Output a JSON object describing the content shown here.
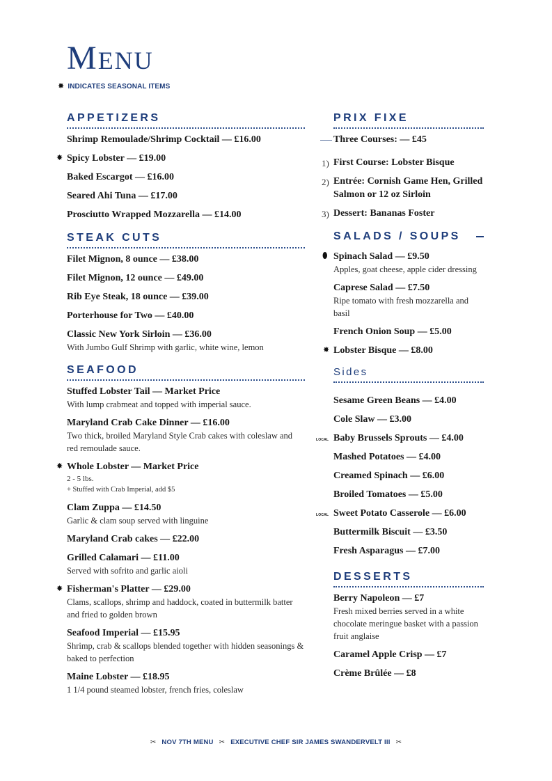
{
  "header": {
    "title_first": "M",
    "title_rest": "ENU",
    "legend_icon": "seasonal-star-icon",
    "legend_text": "INDICATES SEASONAL ITEMS"
  },
  "marker_glyphs": {
    "seasonal": "✸",
    "leaf": "⬮",
    "local": "LOCAL"
  },
  "left": {
    "appetizers": {
      "heading": "APPETIZERS",
      "items": [
        {
          "name": "Shrimp Remoulade/Shrimp Cocktail — £16.00"
        },
        {
          "name": "Spicy Lobster — £19.00",
          "marker": "seasonal"
        },
        {
          "name": "Baked Escargot — £16.00"
        },
        {
          "name": "Seared Ahi Tuna — £17.00"
        },
        {
          "name": "Prosciutto Wrapped Mozzarella — £14.00"
        }
      ]
    },
    "steak": {
      "heading": "STEAK CUTS",
      "items": [
        {
          "name": "Filet Mignon, 8 ounce — £38.00"
        },
        {
          "name": "Filet Mignon, 12 ounce — £49.00"
        },
        {
          "name": "Rib Eye Steak, 18 ounce — £39.00"
        },
        {
          "name": "Porterhouse for Two — £40.00"
        },
        {
          "name": "Classic New York Sirloin — £36.00",
          "desc": "With Jumbo Gulf Shrimp with garlic, white wine, lemon"
        }
      ]
    },
    "seafood": {
      "heading": "SEAFOOD",
      "items": [
        {
          "name": "Stuffed Lobster Tail  — Market Price",
          "desc": "With lump crabmeat and topped with imperial sauce."
        },
        {
          "name": "Maryland Crab Cake Dinner  — £16.00",
          "desc": "Two thick, broiled Maryland Style Crab cakes with coleslaw and red remoulade sauce."
        },
        {
          "name": "Whole Lobster — Market Price",
          "marker": "seasonal",
          "desc": "2 - 5 lbs.",
          "desc2": "+ Stuffed with Crab Imperial, add $5"
        },
        {
          "name": "Clam Zuppa — £14.50",
          "desc": "Garlic & clam soup served with linguine"
        },
        {
          "name": "Maryland Crab cakes — £22.00"
        },
        {
          "name": "Grilled Calamari  — £11.00",
          "desc": "Served with sofrito and garlic aioli"
        },
        {
          "name": "Fisherman's Platter — £29.00",
          "marker": "seasonal",
          "desc": "Clams, scallops, shrimp and haddock, coated in buttermilk batter and fried to golden brown"
        },
        {
          "name": "Seafood Imperial — £15.95",
          "desc": "Shrimp, crab & scallops blended together with hidden seasonings & baked to perfection"
        },
        {
          "name": "Maine Lobster — £18.95",
          "desc": "1 1/4 pound steamed lobster, french fries, coleslaw"
        }
      ]
    }
  },
  "right": {
    "prix_fixe": {
      "heading": "PRIX FIXE",
      "intro": "Three Courses: — £45",
      "courses": [
        {
          "num": "1)",
          "text": "First Course: Lobster Bisque"
        },
        {
          "num": "2)",
          "text": "Entrée: Cornish Game Hen, Grilled Salmon or 12 oz Sirloin"
        },
        {
          "num": "3)",
          "text": "Dessert: Bananas Foster"
        }
      ]
    },
    "salads": {
      "heading": "SALADS / SOUPS",
      "items": [
        {
          "name": "Spinach Salad — £9.50",
          "marker": "leaf",
          "desc": "Apples, goat cheese, apple cider dressing"
        },
        {
          "name": "Caprese Salad — £7.50",
          "desc": "Ripe tomato with fresh mozzarella and basil"
        },
        {
          "name": "French Onion Soup — £5.00"
        },
        {
          "name": "Lobster Bisque — £8.00",
          "marker": "seasonal"
        }
      ]
    },
    "sides": {
      "heading": "Sides",
      "items": [
        {
          "name": "Sesame Green Beans — £4.00"
        },
        {
          "name": "Cole Slaw — £3.00"
        },
        {
          "name": "Baby Brussels Sprouts — £4.00",
          "marker": "local"
        },
        {
          "name": "Mashed Potatoes — £4.00"
        },
        {
          "name": "Creamed Spinach — £6.00"
        },
        {
          "name": "Broiled Tomatoes — £5.00"
        },
        {
          "name": "Sweet Potato Casserole — £6.00",
          "marker": "local"
        },
        {
          "name": "Buttermilk Biscuit — £3.50"
        },
        {
          "name": "Fresh Asparagus — £7.00"
        }
      ]
    },
    "desserts": {
      "heading": "DESSERTS",
      "items": [
        {
          "name": "Berry Napoleon — £7",
          "desc": "Fresh mixed berries served in a white chocolate meringue basket with a passion fruit anglaise"
        },
        {
          "name": "Caramel Apple Crisp — £7"
        },
        {
          "name": "Crème Brûlée — £8"
        }
      ]
    }
  },
  "footer": {
    "icon": "crossed-utensils-icon",
    "icon_glyph": "✂",
    "date": "NOV 7TH MENU",
    "chef": "EXECUTIVE CHEF SIR JAMES SWANDERVELT III"
  }
}
